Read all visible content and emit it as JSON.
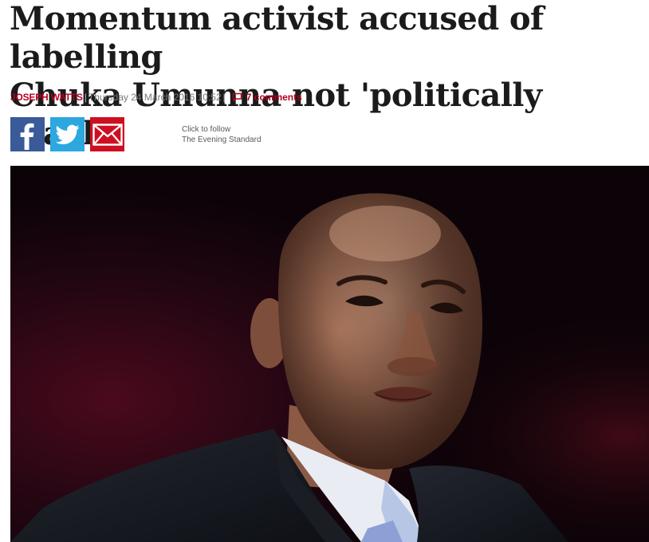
{
  "article": {
    "headline_line1": "Momentum activist accused of labelling",
    "headline_line2": "Chuka Umunna not 'politically black'",
    "author": "JOSEPH WATTS",
    "separator": "|",
    "date": "Thursday 24 March 2016 10:52",
    "comments_label": "7 comments"
  },
  "share": {
    "facebook_icon": "facebook-icon",
    "twitter_icon": "twitter-icon",
    "email_icon": "email-icon"
  },
  "follow": {
    "line1": "Click to follow",
    "line2": "The Evening Standard"
  },
  "colors": {
    "accent": "#b3001e",
    "facebook": "#3a5a99",
    "twitter": "#2ca7e0",
    "email": "#cd1021"
  }
}
